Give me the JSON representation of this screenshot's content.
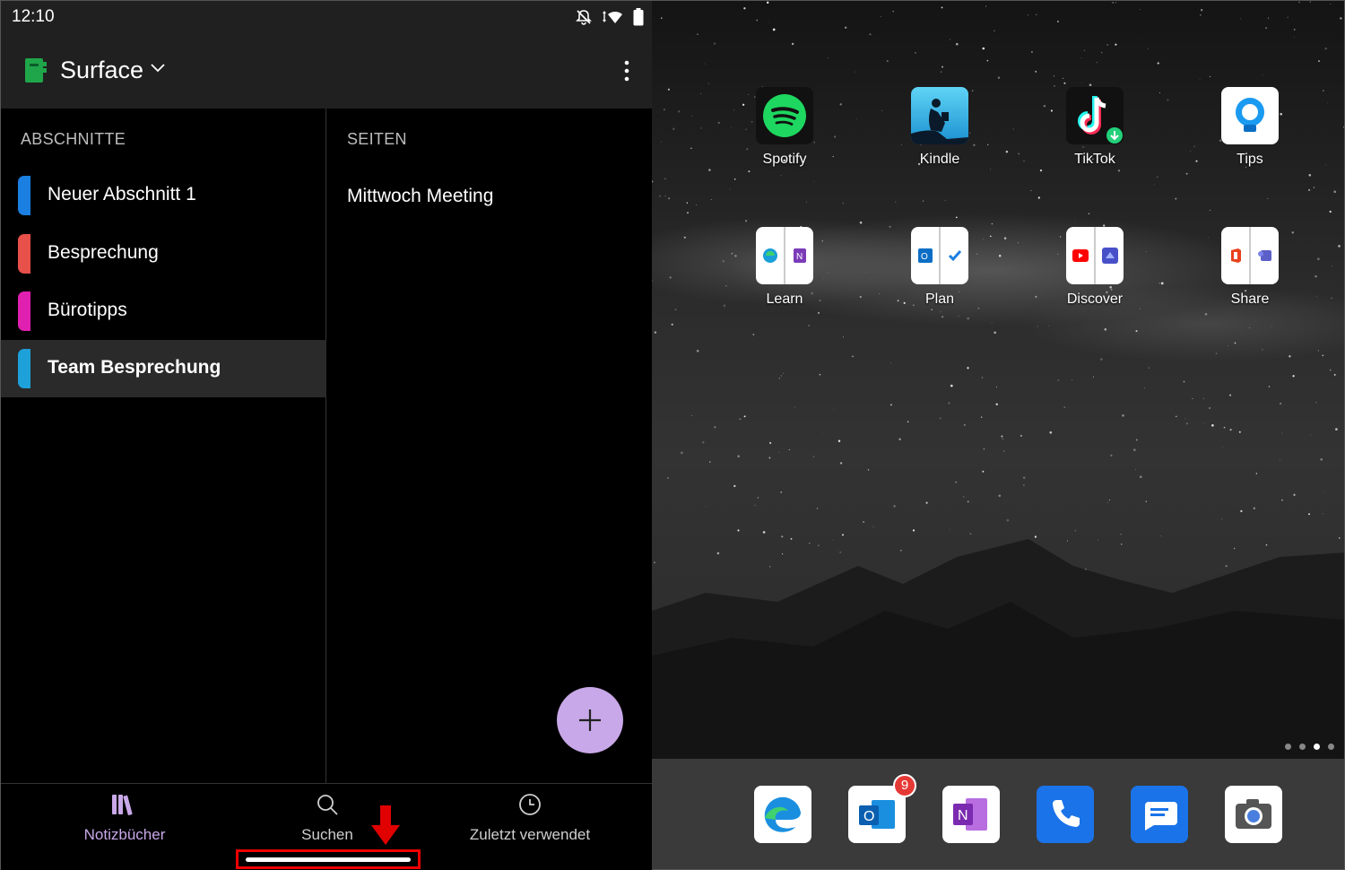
{
  "status": {
    "time": "12:10"
  },
  "notebook": {
    "title": "Surface",
    "color": "#1fa64a"
  },
  "sections": {
    "heading": "ABSCHNITTE",
    "items": [
      {
        "label": "Neuer Abschnitt 1",
        "color": "#1a7fe0"
      },
      {
        "label": "Besprechung",
        "color": "#e8504a"
      },
      {
        "label": "Bürotipps",
        "color": "#e020b0"
      },
      {
        "label": "Team Besprechung",
        "color": "#1ea0d8",
        "selected": true
      }
    ]
  },
  "pages": {
    "heading": "SEITEN",
    "items": [
      "Mittwoch Meeting"
    ]
  },
  "bottom_nav": {
    "notebooks": "Notizbücher",
    "search": "Suchen",
    "recent": "Zuletzt verwendet"
  },
  "launcher": {
    "apps": [
      {
        "label": "Spotify",
        "icon": "spotify-icon"
      },
      {
        "label": "Kindle",
        "icon": "kindle-icon"
      },
      {
        "label": "TikTok",
        "icon": "tiktok-icon"
      },
      {
        "label": "Tips",
        "icon": "tips-icon"
      },
      {
        "label": "Learn",
        "icon": "folder-icon"
      },
      {
        "label": "Plan",
        "icon": "folder-icon"
      },
      {
        "label": "Discover",
        "icon": "folder-icon"
      },
      {
        "label": "Share",
        "icon": "folder-icon"
      }
    ],
    "dock": [
      {
        "name": "edge-icon"
      },
      {
        "name": "outlook-icon",
        "badge": "9"
      },
      {
        "name": "onenote-icon"
      },
      {
        "name": "phone-icon"
      },
      {
        "name": "messages-icon"
      },
      {
        "name": "camera-icon"
      }
    ],
    "page_count": 4,
    "active_page": 3
  },
  "colors": {
    "accent": "#c8a8e8",
    "appbar": "#202020",
    "selected_row": "#2a2a2a",
    "highlight": "#e00000"
  }
}
